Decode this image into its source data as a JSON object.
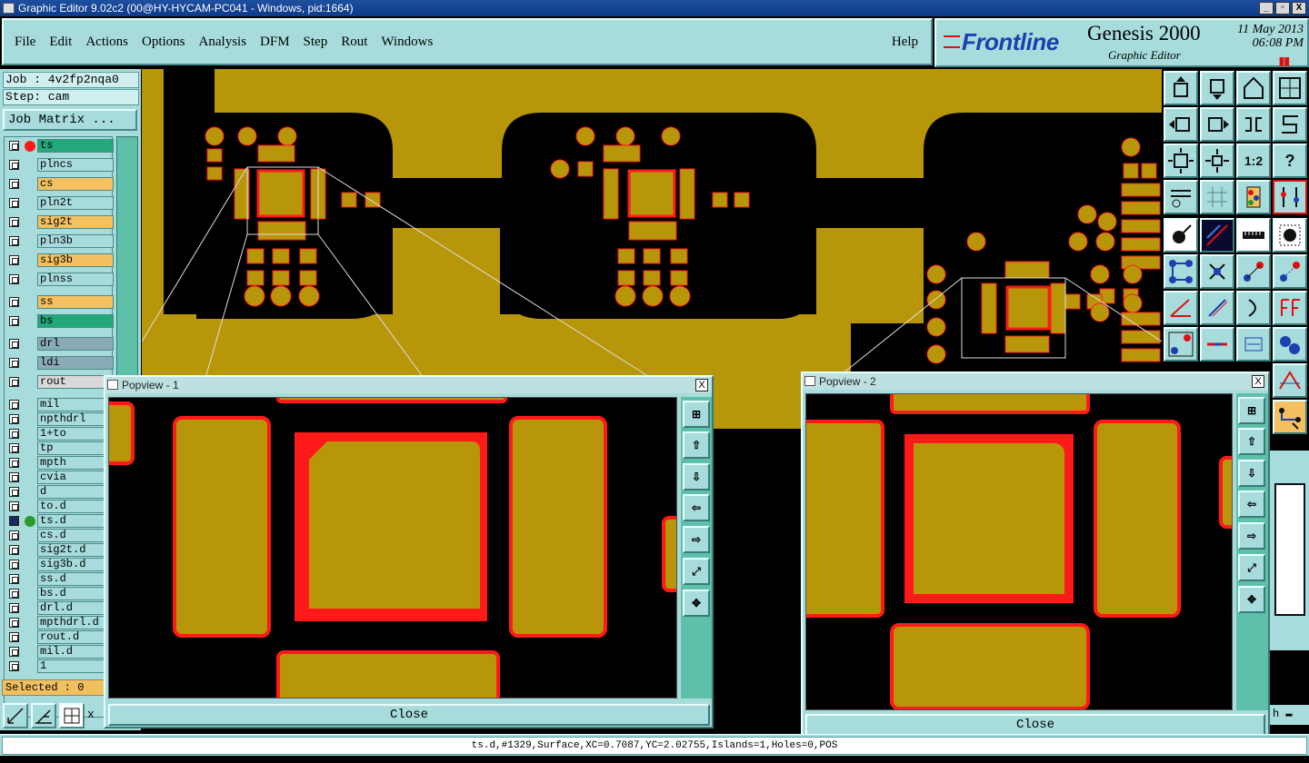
{
  "window": {
    "title": "Graphic Editor 9.02c2 (00@HY-HYCAM-PC041 - Windows, pid:1664)",
    "buttons": [
      "_",
      "▫",
      "X"
    ]
  },
  "menu": {
    "items": [
      "File",
      "Edit",
      "Actions",
      "Options",
      "Analysis",
      "DFM",
      "Step",
      "Rout",
      "Windows"
    ],
    "help": "Help"
  },
  "brand": {
    "logo": "Frontline",
    "product": "Genesis 2000",
    "subtitle": "Graphic Editor",
    "date": "11 May 2013",
    "time": "06:08 PM",
    "pause": "▮▮"
  },
  "left": {
    "job": "Job : 4v2fp2nqa0",
    "step": "Step: cam",
    "job_matrix": "Job Matrix ...",
    "selected": "Selected : 0"
  },
  "layers": [
    {
      "name": "ts",
      "color": "#23a87a",
      "dot": "#ff1a1a"
    },
    {
      "name": "plncs",
      "color": "#a8dcdc",
      "dot": ""
    },
    {
      "name": "cs",
      "color": "#f5c060",
      "dot": ""
    },
    {
      "name": "pln2t",
      "color": "#a8dcdc",
      "dot": ""
    },
    {
      "name": "sig2t",
      "color": "#f5c060",
      "dot": ""
    },
    {
      "name": "pln3b",
      "color": "#a8dcdc",
      "dot": ""
    },
    {
      "name": "sig3b",
      "color": "#f5c060",
      "dot": ""
    },
    {
      "name": "plnss",
      "color": "#a8dcdc",
      "dot": ""
    },
    {
      "name": "ss",
      "color": "#f5c060",
      "dot": ""
    },
    {
      "name": "bs",
      "color": "#23a87a",
      "dot": ""
    },
    {
      "name": "drl",
      "color": "#8aaab8",
      "dot": ""
    },
    {
      "name": "ldi",
      "color": "#8aaab8",
      "dot": ""
    },
    {
      "name": "rout",
      "color": "#d9d9d9",
      "dot": ""
    },
    {
      "name": "mil",
      "color": "#a8dcdc",
      "dot": ""
    },
    {
      "name": "npthdrl",
      "color": "#a8dcdc",
      "dot": ""
    },
    {
      "name": "1+to",
      "color": "#a8dcdc",
      "dot": ""
    },
    {
      "name": "tp",
      "color": "#a8dcdc",
      "dot": ""
    },
    {
      "name": "mpth",
      "color": "#a8dcdc",
      "dot": ""
    },
    {
      "name": "cvia",
      "color": "#a8dcdc",
      "dot": ""
    },
    {
      "name": "d",
      "color": "#a8dcdc",
      "dot": ""
    },
    {
      "name": "to.d",
      "color": "#a8dcdc",
      "dot": ""
    },
    {
      "name": "ts.d",
      "color": "#a8dcdc",
      "dot": "#2a9a2a"
    },
    {
      "name": "cs.d",
      "color": "#a8dcdc",
      "dot": ""
    },
    {
      "name": "sig2t.d",
      "color": "#a8dcdc",
      "dot": ""
    },
    {
      "name": "sig3b.d",
      "color": "#a8dcdc",
      "dot": ""
    },
    {
      "name": "ss.d",
      "color": "#a8dcdc",
      "dot": ""
    },
    {
      "name": "bs.d",
      "color": "#a8dcdc",
      "dot": ""
    },
    {
      "name": "drl.d",
      "color": "#a8dcdc",
      "dot": ""
    },
    {
      "name": "mpthdrl.d",
      "color": "#a8dcdc",
      "dot": ""
    },
    {
      "name": "rout.d",
      "color": "#a8dcdc",
      "dot": ""
    },
    {
      "name": "mil.d",
      "color": "#a8dcdc",
      "dot": ""
    },
    {
      "name": "1",
      "color": "#a8dcdc",
      "dot": ""
    }
  ],
  "popview1": {
    "title": "Popview - 1",
    "close": "Close",
    "x": "X"
  },
  "popview2": {
    "title": "Popview - 2",
    "close": "Close",
    "x": "X"
  },
  "toolbar": {
    "ratio_label": "1:2",
    "help_label": "?"
  },
  "status": {
    "message": "ts.d,#1329,Surface,XC=0.7087,YC=2.02755,Islands=1,Holes=0,POS"
  },
  "colors": {
    "copper": "#b8960a",
    "highlight": "#ff1a1a",
    "panel": "#a8dcdc"
  }
}
